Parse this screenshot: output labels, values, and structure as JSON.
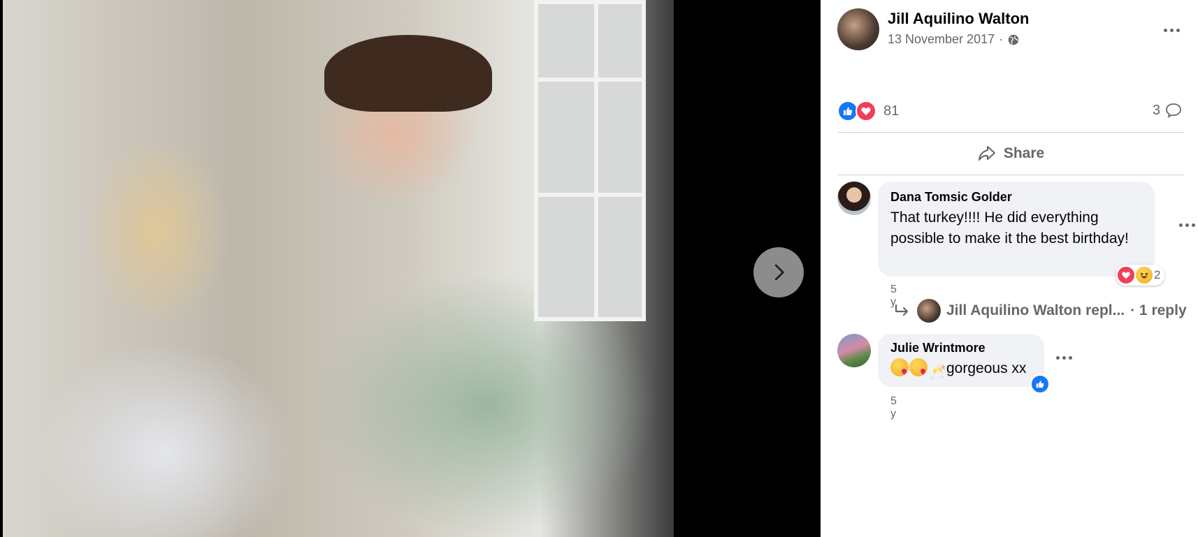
{
  "post": {
    "author": "Jill Aquilino Walton",
    "date": "13 November 2017",
    "separator": "·",
    "reaction_count": "81",
    "comment_count": "3",
    "share_label": "Share"
  },
  "comments": [
    {
      "name": "Dana Tomsic Golder",
      "text": "That turkey!!!! He did everything possible to make it the best birthday!",
      "time": "5 y",
      "reaction_count": "2"
    },
    {
      "name": "Julie Wrintmore",
      "text": "gorgeous xx",
      "time": "5 y"
    }
  ],
  "reply": {
    "author": "Jill Aquilino Walton",
    "text": "Jill Aquilino Walton repl...",
    "count_label": "· 1 reply"
  },
  "colors": {
    "like_blue": "#1877f2",
    "love_red": "#f33e58",
    "secondary_text": "#65676b",
    "bubble_bg": "#f0f2f5"
  },
  "icons": [
    "globe-icon",
    "more-dots-icon",
    "like-icon",
    "love-icon",
    "comment-icon",
    "share-icon",
    "chevron-right-icon",
    "reply-arrow-icon",
    "haha-icon"
  ]
}
